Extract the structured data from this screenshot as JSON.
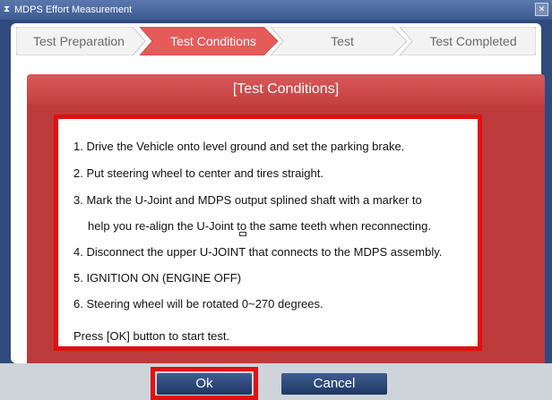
{
  "window": {
    "title": "MDPS Effort Measurement",
    "title_icon": "hourglass-icon",
    "close_icon": "close-icon"
  },
  "steps": [
    {
      "label": "Test Preparation",
      "state": "inactive"
    },
    {
      "label": "Test Conditions",
      "state": "active"
    },
    {
      "label": "Test",
      "state": "inactive"
    },
    {
      "label": "Test Completed",
      "state": "inactive"
    }
  ],
  "section": {
    "header": "[Test Conditions]",
    "lines": [
      "1. Drive the Vehicle onto level ground and set the parking brake.",
      "2. Put steering wheel to center and tires straight.",
      "3. Mark the U-Joint and MDPS output splined shaft with a marker to",
      "help you re-align the U-Joint to the same teeth when reconnecting.",
      "4. Disconnect the upper U-JOINT that connects to the MDPS assembly.",
      "5. IGNITION ON (ENGINE OFF)",
      "6. Steering wheel will be rotated 0~270 degrees.",
      "Press [OK] button to start test."
    ]
  },
  "buttons": {
    "ok_label": "Ok",
    "cancel_label": "Cancel"
  },
  "colors": {
    "accent_red": "#c44041",
    "highlight_red": "#e01010",
    "button_blue": "#2c4775",
    "window_blue": "#2f4a7c"
  }
}
